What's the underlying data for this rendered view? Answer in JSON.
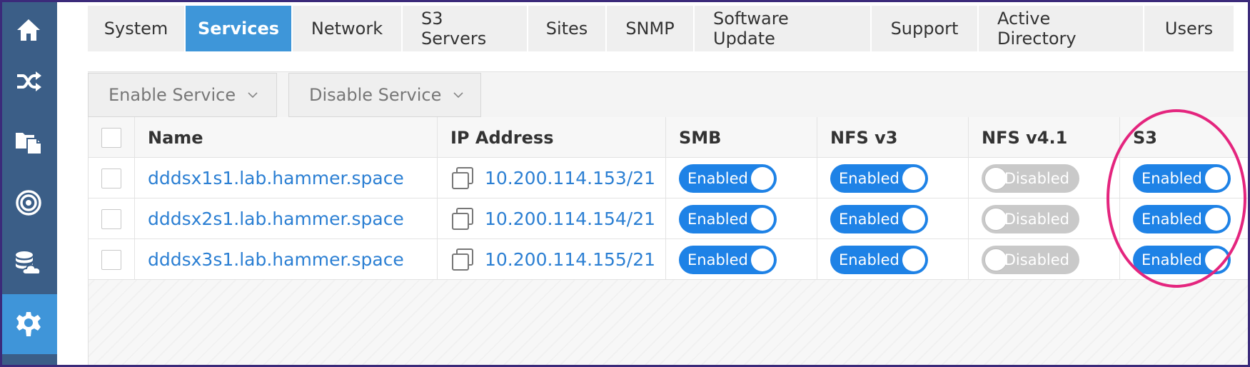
{
  "sidebar": {
    "items": [
      {
        "icon": "home-icon"
      },
      {
        "icon": "shuffle-icon"
      },
      {
        "icon": "files-icon"
      },
      {
        "icon": "target-icon"
      },
      {
        "icon": "database-cloud-icon"
      },
      {
        "icon": "gear-icon",
        "active": true
      }
    ],
    "colors": {
      "background": "#3b5e87",
      "active": "#3f95d9"
    }
  },
  "tabs": [
    {
      "label": "System"
    },
    {
      "label": "Services",
      "active": true
    },
    {
      "label": "Network"
    },
    {
      "label": "S3 Servers"
    },
    {
      "label": "Sites"
    },
    {
      "label": "SNMP"
    },
    {
      "label": "Software Update"
    },
    {
      "label": "Support"
    },
    {
      "label": "Active Directory"
    },
    {
      "label": "Users"
    }
  ],
  "toolbar": {
    "enable_label": "Enable Service",
    "disable_label": "Disable Service"
  },
  "table": {
    "headers": {
      "name": "Name",
      "ip": "IP Address",
      "smb": "SMB",
      "nfs3": "NFS v3",
      "nfs41": "NFS v4.1",
      "s3": "S3"
    },
    "rows": [
      {
        "name": "dddsx1s1.lab.hammer.space",
        "ip": "10.200.114.153/21",
        "smb": "Enabled",
        "nfs3": "Enabled",
        "nfs41": "Disabled",
        "s3": "Enabled"
      },
      {
        "name": "dddsx2s1.lab.hammer.space",
        "ip": "10.200.114.154/21",
        "smb": "Enabled",
        "nfs3": "Enabled",
        "nfs41": "Disabled",
        "s3": "Enabled"
      },
      {
        "name": "dddsx3s1.lab.hammer.space",
        "ip": "10.200.114.155/21",
        "smb": "Enabled",
        "nfs3": "Enabled",
        "nfs41": "Disabled",
        "s3": "Enabled"
      }
    ]
  },
  "colors": {
    "accent": "#3e96d9",
    "toggle_on": "#1e82e6",
    "toggle_off": "#c9c9c9",
    "link": "#2b7fd3",
    "annotation": "#e4257e"
  }
}
